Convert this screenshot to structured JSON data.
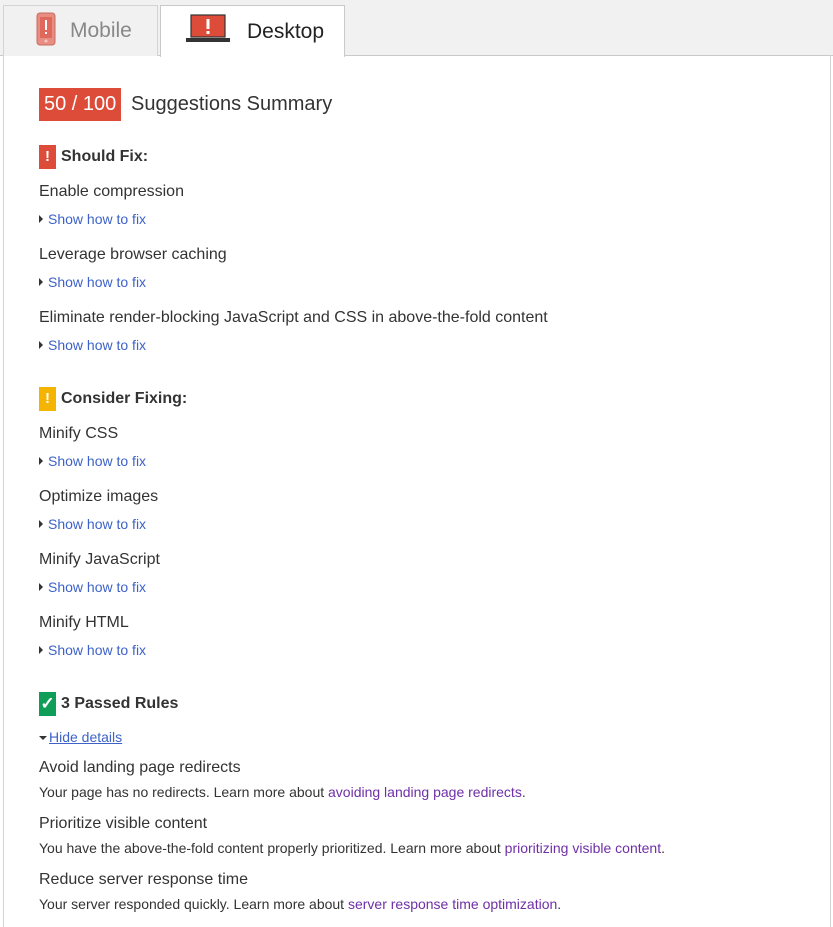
{
  "tabs": [
    {
      "label": "Mobile",
      "icon": "mobile-phone-icon",
      "active": false
    },
    {
      "label": "Desktop",
      "icon": "desktop-monitor-icon",
      "active": true
    }
  ],
  "score": "50 / 100",
  "summary_title": "Suggestions Summary",
  "should_fix": {
    "heading": "Should Fix:",
    "badge": "!",
    "items": [
      {
        "title": "Enable compression",
        "link": "Show how to fix"
      },
      {
        "title": "Leverage browser caching",
        "link": "Show how to fix"
      },
      {
        "title": "Eliminate render-blocking JavaScript and CSS in above-the-fold content",
        "link": "Show how to fix"
      }
    ]
  },
  "consider_fixing": {
    "heading": "Consider Fixing:",
    "badge": "!",
    "items": [
      {
        "title": "Minify CSS",
        "link": "Show how to fix"
      },
      {
        "title": "Optimize images",
        "link": "Show how to fix"
      },
      {
        "title": "Minify JavaScript",
        "link": "Show how to fix"
      },
      {
        "title": "Minify HTML",
        "link": "Show how to fix"
      }
    ]
  },
  "passed": {
    "heading": "3 Passed Rules",
    "badge": "✓",
    "toggle": "Hide details",
    "items": [
      {
        "title": "Avoid landing page redirects",
        "text": "Your page has no redirects. Learn more about ",
        "link": "avoiding landing page redirects",
        "end": "."
      },
      {
        "title": "Prioritize visible content",
        "text": "You have the above-the-fold content properly prioritized. Learn more about ",
        "link": "prioritizing visible content",
        "end": "."
      },
      {
        "title": "Reduce server response time",
        "text": "Your server responded quickly. Learn more about ",
        "link": "server response time optimization",
        "end": "."
      }
    ]
  },
  "colors": {
    "red": "#dd4b39",
    "orange": "#f4b400",
    "green": "#0f9d58",
    "link": "#3d62c8",
    "visited_link": "#6f2fa7"
  }
}
